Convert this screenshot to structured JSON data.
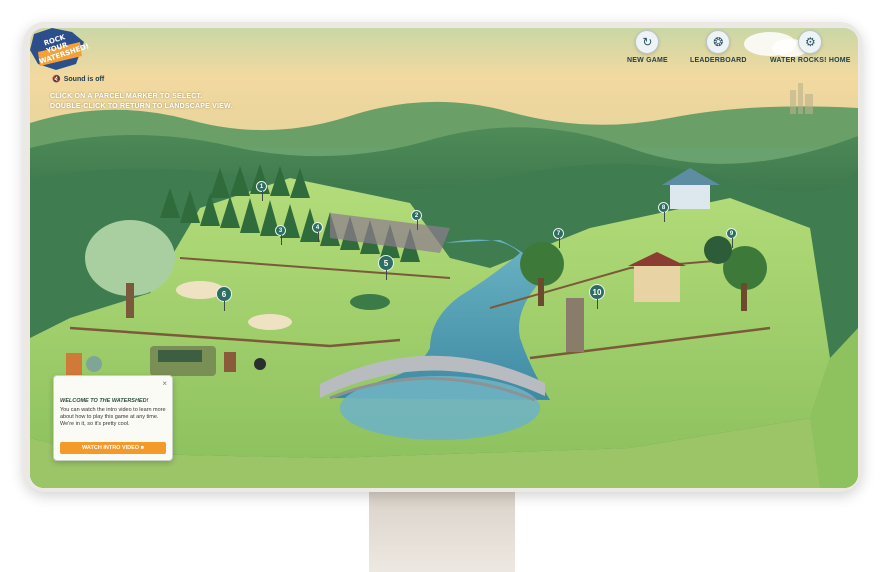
{
  "logo": {
    "text": "ROCK YOUR WATERSHED!"
  },
  "nav": [
    {
      "label": "NEW GAME",
      "icon": "refresh-icon"
    },
    {
      "label": "LEADERBOARD",
      "icon": "trophy-icon"
    },
    {
      "label": "WATER ROCKS! HOME",
      "icon": "gear-icon"
    }
  ],
  "sound": {
    "label": "Sound is off",
    "icon": "speaker-muted-icon"
  },
  "instructions": {
    "line1": "CLICK ON A PARCEL MARKER TO SELECT.",
    "line2": "DOUBLE-CLICK TO RETURN TO LANDSCAPE VIEW."
  },
  "markers": [
    "1",
    "2",
    "3",
    "4",
    "5",
    "6",
    "7",
    "8",
    "9",
    "10"
  ],
  "welcome": {
    "title": "WELCOME TO THE WATERSHED!",
    "body": "You can watch the intro video to learn more about how to play this game at any time. We're in it, so it's pretty cool.",
    "button": "WATCH INTRO VIDEO",
    "close": "×"
  },
  "colors": {
    "accent": "#f39a2b",
    "marker": "#2e6e62",
    "water": "#5fa6b8"
  }
}
